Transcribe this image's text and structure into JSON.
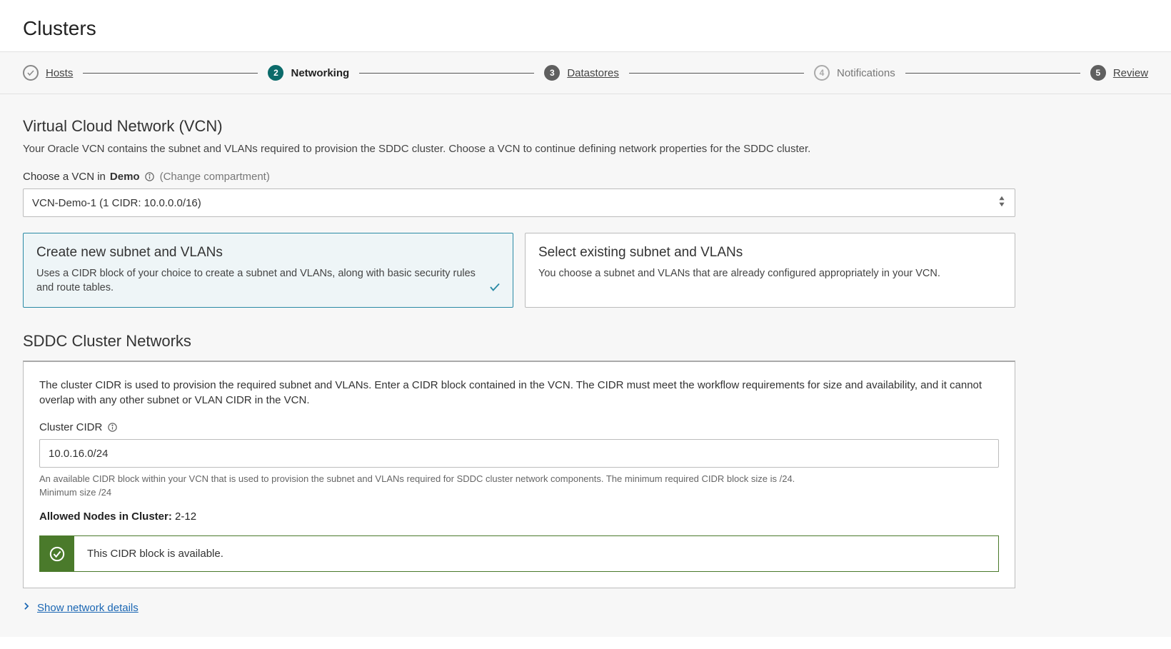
{
  "page_title": "Clusters",
  "stepper": {
    "step1": "Hosts",
    "step2": "Networking",
    "step3": "Datastores",
    "step4": "Notifications",
    "step5": "Review"
  },
  "vcn": {
    "title": "Virtual Cloud Network (VCN)",
    "description": "Your Oracle VCN contains the subnet and VLANs required to provision the SDDC cluster. Choose a VCN to continue defining network properties for the SDDC cluster.",
    "choose_prefix": "Choose a VCN in ",
    "compartment": "Demo",
    "change_compartment": "(Change compartment)",
    "selected": "VCN-Demo-1 (1 CIDR: 10.0.0.0/16)"
  },
  "options": {
    "create": {
      "title": "Create new subnet and VLANs",
      "desc": "Uses a CIDR block of your choice to create a subnet and VLANs, along with basic security rules and route tables."
    },
    "select": {
      "title": "Select existing subnet and VLANs",
      "desc": "You choose a subnet and VLANs that are already configured appropriately in your VCN."
    }
  },
  "sddc": {
    "title": "SDDC Cluster Networks",
    "panel_desc": "The cluster CIDR is used to provision the required subnet and VLANs. Enter a CIDR block contained in the VCN. The CIDR must meet the workflow requirements for size and availability, and it cannot overlap with any other subnet or VLAN CIDR in the VCN.",
    "cidr_label": "Cluster CIDR",
    "cidr_value": "10.0.16.0/24",
    "cidr_help": "An available CIDR block within your VCN that is used to provision the subnet and VLANs required for SDDC cluster network components. The minimum required CIDR block size is /24.",
    "cidr_min": "Minimum size /24",
    "allowed_label": "Allowed Nodes in Cluster:",
    "allowed_value": " 2-12",
    "alert_text": "This CIDR block is available."
  },
  "details_link": "Show network details"
}
